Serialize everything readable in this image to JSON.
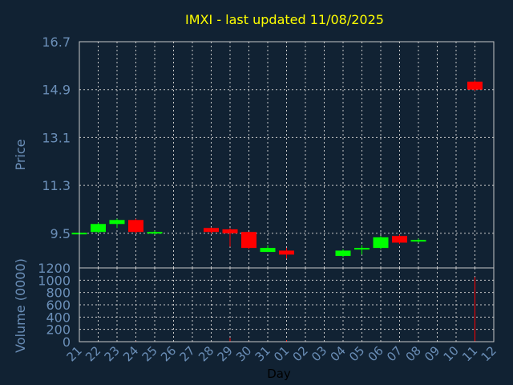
{
  "chart_data": {
    "type": "candlestick",
    "title": "IMXI - last updated 11/08/2025",
    "xlabel": "Day",
    "ylabel_price": "Price",
    "ylabel_volume": "Volume (0000)",
    "x_ticks": [
      "21",
      "22",
      "23",
      "24",
      "25",
      "26",
      "27",
      "28",
      "29",
      "30",
      "31",
      "01",
      "02",
      "03",
      "04",
      "05",
      "06",
      "07",
      "08",
      "09",
      "10",
      "11",
      "12"
    ],
    "price_ticks": [
      "9.5",
      "11.3",
      "13.1",
      "14.9",
      "16.7"
    ],
    "price_ylim": [
      8.2,
      16.7
    ],
    "volume_ticks": [
      "0",
      "200",
      "400",
      "600",
      "800",
      "1000",
      "1200"
    ],
    "volume_ylim": [
      0,
      1200
    ],
    "grid": true,
    "colors": {
      "up": "#00ff00",
      "down": "#ff0000",
      "title": "#ffff00",
      "axis_text": "#6b8fb8",
      "background": "#112233"
    },
    "candles": [
      {
        "day": "21",
        "open": 9.47,
        "close": 9.52,
        "high": 9.55,
        "low": 9.45,
        "volume": 5
      },
      {
        "day": "22",
        "open": 9.55,
        "close": 9.85,
        "high": 9.9,
        "low": 9.5,
        "volume": 6
      },
      {
        "day": "23",
        "open": 9.85,
        "close": 10.0,
        "high": 10.05,
        "low": 9.7,
        "volume": 7
      },
      {
        "day": "24",
        "open": 10.0,
        "close": 9.55,
        "high": 10.05,
        "low": 9.5,
        "volume": 10
      },
      {
        "day": "25",
        "open": 9.5,
        "close": 9.55,
        "high": 9.6,
        "low": 9.45,
        "volume": 6
      },
      {
        "day": "28",
        "open": 9.7,
        "close": 9.55,
        "high": 9.72,
        "low": 9.5,
        "volume": 5
      },
      {
        "day": "29",
        "open": 9.65,
        "close": 9.5,
        "high": 9.7,
        "low": 9.0,
        "volume": 60
      },
      {
        "day": "30",
        "open": 9.55,
        "close": 8.95,
        "high": 9.55,
        "low": 8.9,
        "volume": 8
      },
      {
        "day": "31",
        "open": 8.8,
        "close": 8.95,
        "high": 9.05,
        "low": 8.8,
        "volume": 6
      },
      {
        "day": "01",
        "open": 8.85,
        "close": 8.7,
        "high": 8.95,
        "low": 8.55,
        "volume": 25
      },
      {
        "day": "04",
        "open": 8.65,
        "close": 8.85,
        "high": 8.9,
        "low": 8.6,
        "volume": 6
      },
      {
        "day": "05",
        "open": 8.9,
        "close": 8.95,
        "high": 9.05,
        "low": 8.7,
        "volume": 5
      },
      {
        "day": "06",
        "open": 8.95,
        "close": 9.35,
        "high": 9.4,
        "low": 8.9,
        "volume": 6
      },
      {
        "day": "07",
        "open": 9.4,
        "close": 9.15,
        "high": 9.45,
        "low": 9.1,
        "volume": 5
      },
      {
        "day": "08",
        "open": 9.2,
        "close": 9.25,
        "high": 9.3,
        "low": 9.15,
        "volume": 4
      },
      {
        "day": "11",
        "open": 15.2,
        "close": 14.9,
        "high": 15.25,
        "low": 14.85,
        "volume": 1050
      }
    ]
  }
}
